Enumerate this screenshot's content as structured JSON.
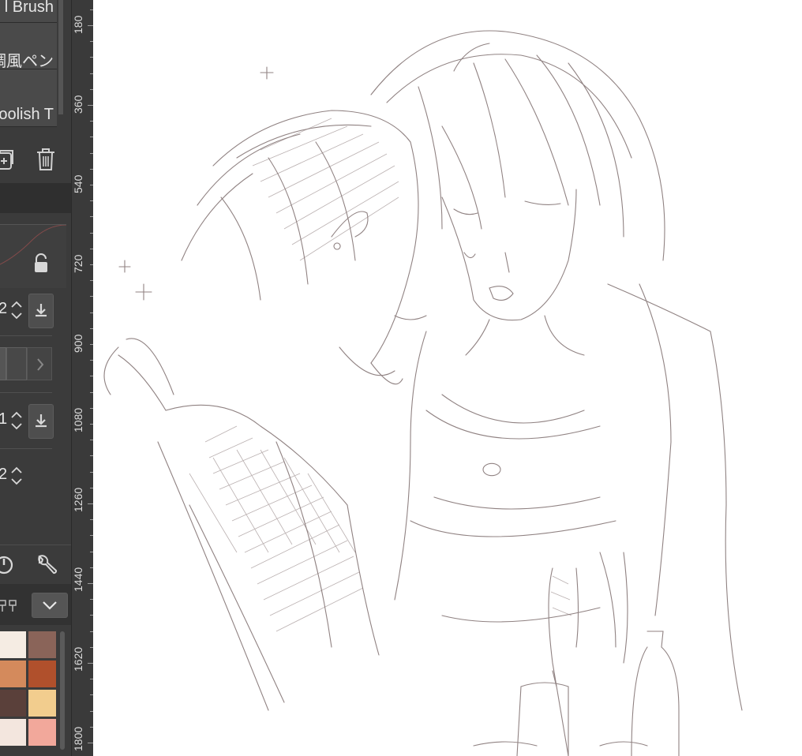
{
  "brush_list": {
    "items": [
      {
        "label": "l Brush"
      },
      {
        "label": "調風ペン"
      },
      {
        "label": "oolish T"
      }
    ]
  },
  "brush_toolbar": {
    "icons": [
      "add-subtool-icon",
      "trash-icon"
    ]
  },
  "properties": {
    "value_1": "2",
    "value_2": "1",
    "value_3": "2",
    "icons": [
      "lock-icon",
      "download-icon",
      "chevron-right-icon",
      "dial-icon",
      "wrench-icon",
      "chevron-down-icon",
      "layer-tree-icon"
    ]
  },
  "ruler": {
    "labels": [
      "180",
      "360",
      "540",
      "720",
      "900",
      "1080",
      "1260",
      "1440",
      "1620",
      "1800"
    ]
  },
  "palette": {
    "colors": [
      [
        "#f5ece3",
        "#8a6459"
      ],
      [
        "#d48a5c",
        "#b0502c"
      ],
      [
        "#5a403a",
        "#f2cd8e"
      ],
      [
        "#f3e6de",
        "#f2a89b"
      ]
    ]
  },
  "canvas": {
    "subject": "pencil-sketch"
  }
}
